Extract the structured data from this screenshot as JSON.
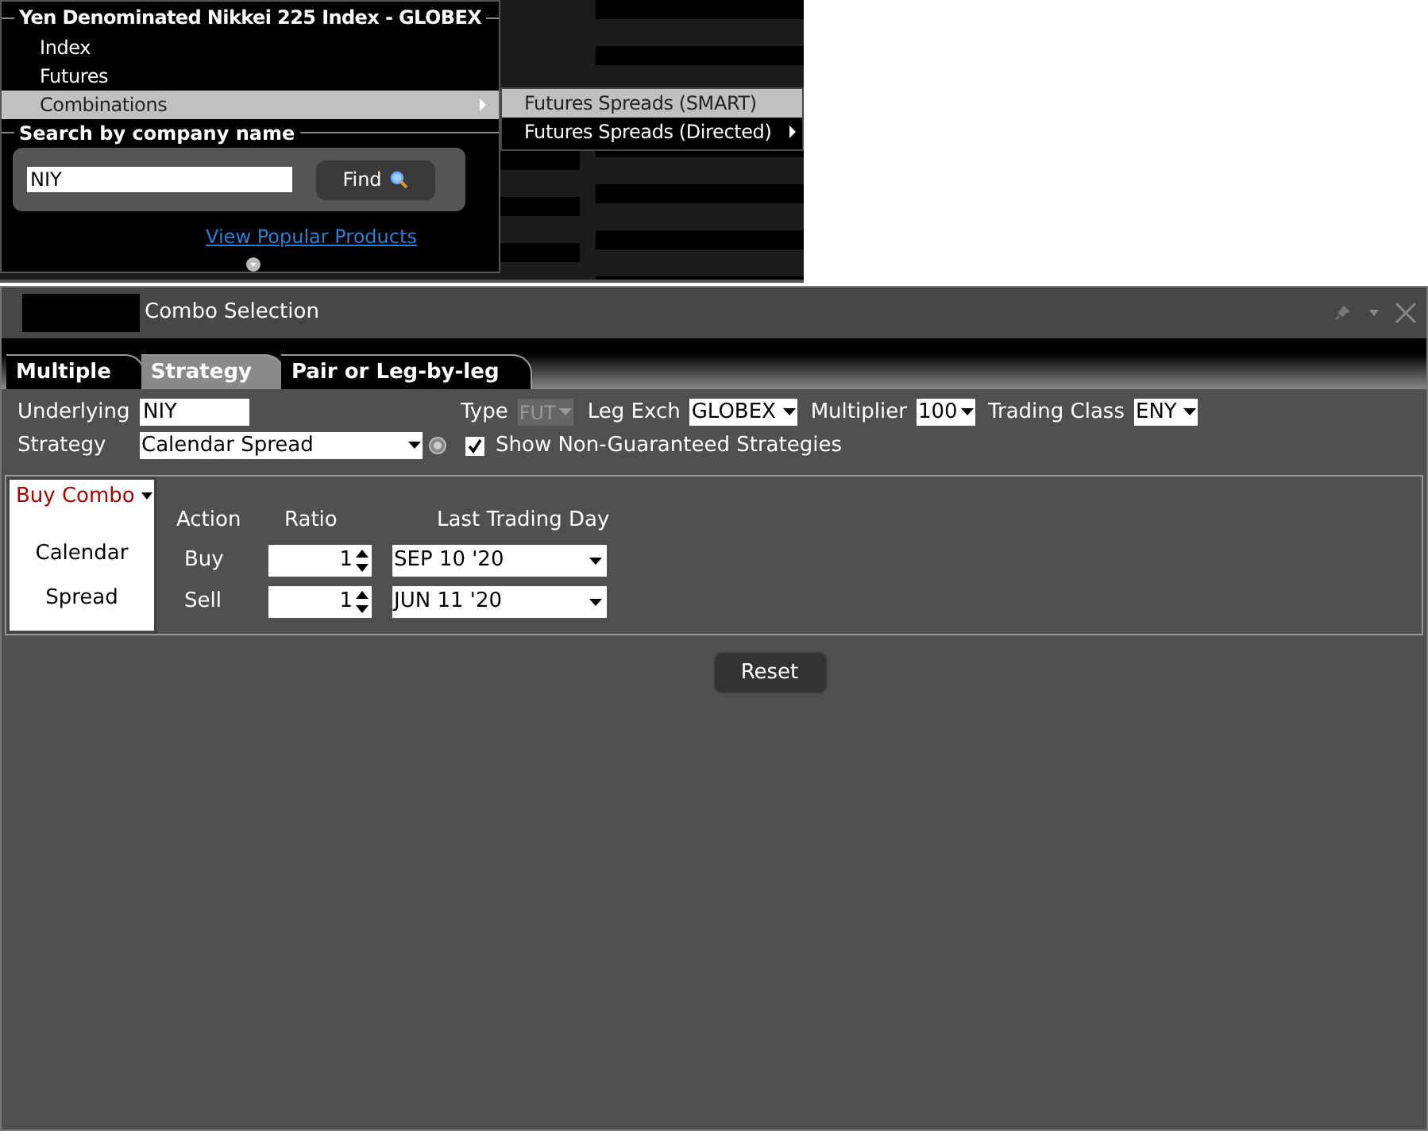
{
  "menu": {
    "title": "Yen Denominated Nikkei 225 Index - GLOBEX",
    "items": [
      {
        "label": "Index",
        "selected": false,
        "submenu": false
      },
      {
        "label": "Futures",
        "selected": false,
        "submenu": false
      },
      {
        "label": "Combinations",
        "selected": true,
        "submenu": true
      }
    ],
    "submenu": [
      {
        "label": "Futures Spreads (SMART)",
        "selected": true,
        "submenu": false
      },
      {
        "label": "Futures Spreads (Directed)",
        "selected": false,
        "submenu": true
      }
    ],
    "search": {
      "title": "Search by company name",
      "value": "NIY",
      "button": "Find",
      "link": "View Popular Products"
    }
  },
  "window": {
    "title": "Combo Selection"
  },
  "tabs": [
    {
      "label": "Multiple",
      "selected": false
    },
    {
      "label": "Strategy",
      "selected": true
    },
    {
      "label": "Pair or Leg-by-leg",
      "selected": false
    }
  ],
  "form": {
    "underlying_label": "Underlying",
    "underlying": "NIY",
    "type_label": "Type",
    "type": "FUT",
    "type_disabled": true,
    "leg_exch_label": "Leg Exch",
    "leg_exch": "GLOBEX",
    "multiplier_label": "Multiplier",
    "multiplier": "100",
    "trading_class_label": "Trading Class",
    "trading_class": "ENY",
    "strategy_label": "Strategy",
    "strategy": "Calendar Spread",
    "show_non_guaranteed": {
      "label": "Show Non-Guaranteed Strategies",
      "checked": true
    }
  },
  "combo": {
    "side": "Buy Combo",
    "name": "Calendar Spread"
  },
  "legs": {
    "columns": [
      "Action",
      "Ratio",
      "Last Trading Day"
    ],
    "rows": [
      {
        "action": "Buy",
        "ratio": "1",
        "last_trading_day": "SEP 10 '20"
      },
      {
        "action": "Sell",
        "ratio": "1",
        "last_trading_day": "JUN 11 '20"
      }
    ]
  },
  "reset": "Reset"
}
